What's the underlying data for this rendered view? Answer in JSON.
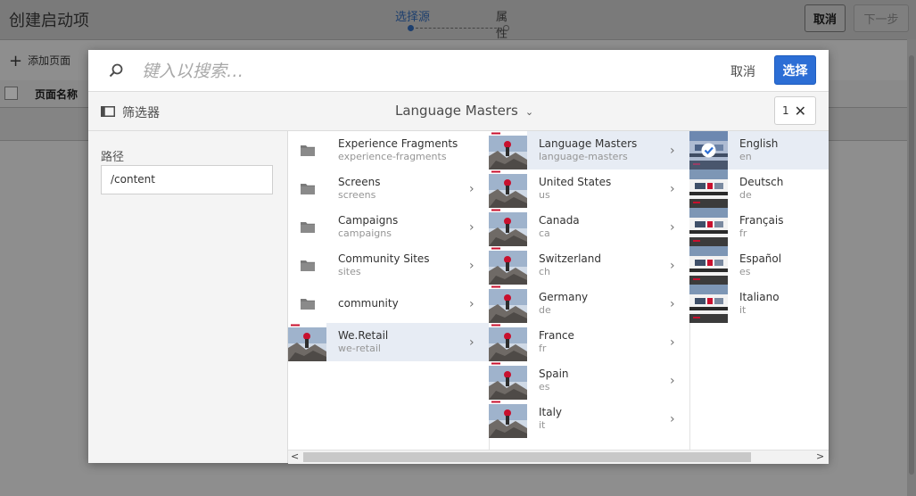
{
  "page": {
    "title": "创建启动项",
    "steps": [
      {
        "label": "选择源"
      },
      {
        "label": "属性"
      }
    ],
    "cancel_label": "取消",
    "next_label": "下一步",
    "add_page_label": "添加页面",
    "column_header_name": "页面名称",
    "plus_icon": "+"
  },
  "modal": {
    "search_placeholder": "键入以搜索…",
    "cancel_label": "取消",
    "select_label": "选择",
    "filter_label": "筛选器",
    "breadcrumb": "Language Masters",
    "selection_count": "1",
    "path_label": "路径",
    "path_value": "/content",
    "columns": [
      {
        "items": [
          {
            "title": "Experience Fragments",
            "sub": "experience-fragments",
            "icon": "folder-icon",
            "has_children": false,
            "selected": false
          },
          {
            "title": "Screens",
            "sub": "screens",
            "icon": "folder-icon",
            "has_children": true,
            "selected": false
          },
          {
            "title": "Campaigns",
            "sub": "campaigns",
            "icon": "folder-icon",
            "has_children": true,
            "selected": false
          },
          {
            "title": "Community Sites",
            "sub": "sites",
            "icon": "folder-icon",
            "has_children": true,
            "selected": false
          },
          {
            "title": "community",
            "sub": "",
            "icon": "folder-icon",
            "has_children": true,
            "selected": false
          },
          {
            "title": "We.Retail",
            "sub": "we-retail",
            "icon": "thumbnail",
            "has_children": true,
            "selected": true
          }
        ]
      },
      {
        "items": [
          {
            "title": "Language Masters",
            "sub": "language-masters",
            "icon": "thumbnail",
            "has_children": true,
            "selected": true
          },
          {
            "title": "United States",
            "sub": "us",
            "icon": "thumbnail",
            "has_children": true,
            "selected": false
          },
          {
            "title": "Canada",
            "sub": "ca",
            "icon": "thumbnail",
            "has_children": true,
            "selected": false
          },
          {
            "title": "Switzerland",
            "sub": "ch",
            "icon": "thumbnail",
            "has_children": true,
            "selected": false
          },
          {
            "title": "Germany",
            "sub": "de",
            "icon": "thumbnail",
            "has_children": true,
            "selected": false
          },
          {
            "title": "France",
            "sub": "fr",
            "icon": "thumbnail",
            "has_children": true,
            "selected": false
          },
          {
            "title": "Spain",
            "sub": "es",
            "icon": "thumbnail",
            "has_children": true,
            "selected": false
          },
          {
            "title": "Italy",
            "sub": "it",
            "icon": "thumbnail",
            "has_children": true,
            "selected": false
          }
        ]
      },
      {
        "items": [
          {
            "title": "English",
            "sub": "en",
            "icon": "thumbnail-checked",
            "has_children": false,
            "selected": true
          },
          {
            "title": "Deutsch",
            "sub": "de",
            "icon": "site-thumbnail",
            "has_children": false,
            "selected": false
          },
          {
            "title": "Français",
            "sub": "fr",
            "icon": "site-thumbnail",
            "has_children": false,
            "selected": false
          },
          {
            "title": "Español",
            "sub": "es",
            "icon": "site-thumbnail",
            "has_children": false,
            "selected": false
          },
          {
            "title": "Italiano",
            "sub": "it",
            "icon": "site-thumbnail",
            "has_children": false,
            "selected": false
          }
        ]
      }
    ],
    "scroll_left_glyph": "<",
    "scroll_right_glyph": ">"
  },
  "colors": {
    "accent": "#2c6ed5",
    "selected_row": "#e7ecf4",
    "overlay": "#8e8e8e"
  }
}
